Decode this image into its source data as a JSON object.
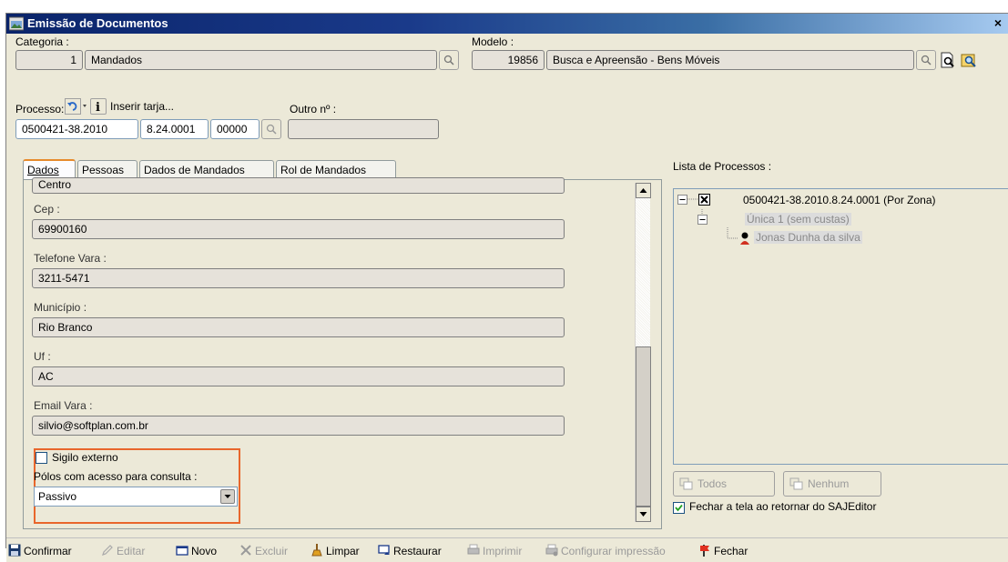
{
  "window": {
    "title": "Emissão de Documentos",
    "close_glyph": "×"
  },
  "categoria": {
    "label": "Categoria :",
    "code": "1",
    "name": "Mandados"
  },
  "modelo": {
    "label": "Modelo :",
    "code": "19856",
    "name": "Busca e Apreensão - Bens Móveis"
  },
  "processo": {
    "label": "Processo:",
    "inserir_tarja": "Inserir tarja...",
    "outro_label": "Outro nº :",
    "part1": "0500421-38.2010",
    "part2": "8.24.0001",
    "part3": "00000",
    "outro_value": ""
  },
  "tabs": [
    {
      "label": "Dados",
      "active": true
    },
    {
      "label": "Pessoas",
      "active": false
    },
    {
      "label": "Dados de Mandados",
      "active": false
    },
    {
      "label": "Rol de Mandados",
      "active": false
    }
  ],
  "form": {
    "bairro_value": "Centro",
    "cep_label": "Cep :",
    "cep_value": "69900160",
    "telefone_label": "Telefone Vara :",
    "telefone_value": "3211-5471",
    "municipio_label": "Município :",
    "municipio_value": "Rio Branco",
    "uf_label": "Uf :",
    "uf_value": "AC",
    "email_label": "Email Vara :",
    "email_value": "silvio@softplan.com.br",
    "sigilo_label": "Sigilo externo",
    "sigilo_checked": false,
    "polos_label": "Pólos com acesso para consulta :",
    "polos_value": "Passivo"
  },
  "lista": {
    "label": "Lista de Processos :",
    "items": [
      {
        "text": "0500421-38.2010.8.24.0001 (Por Zona)"
      },
      {
        "text": "Única 1 (sem custas)"
      },
      {
        "text": "Jonas Dunha da silva"
      }
    ],
    "todos_label": "Todos",
    "nenhum_label": "Nenhum",
    "fechar_label": "Fechar a tela ao retornar do SAJEditor",
    "fechar_checked": true
  },
  "toolbar": {
    "confirmar": "Confirmar",
    "editar": "Editar",
    "novo": "Novo",
    "excluir": "Excluir",
    "limpar": "Limpar",
    "restaurar": "Restaurar",
    "imprimir": "Imprimir",
    "configurar": "Configurar impressão",
    "fechar": "Fechar"
  },
  "colors": {
    "highlight": "#e8662c",
    "title_start": "#0a246a",
    "title_end": "#a6caf0"
  }
}
